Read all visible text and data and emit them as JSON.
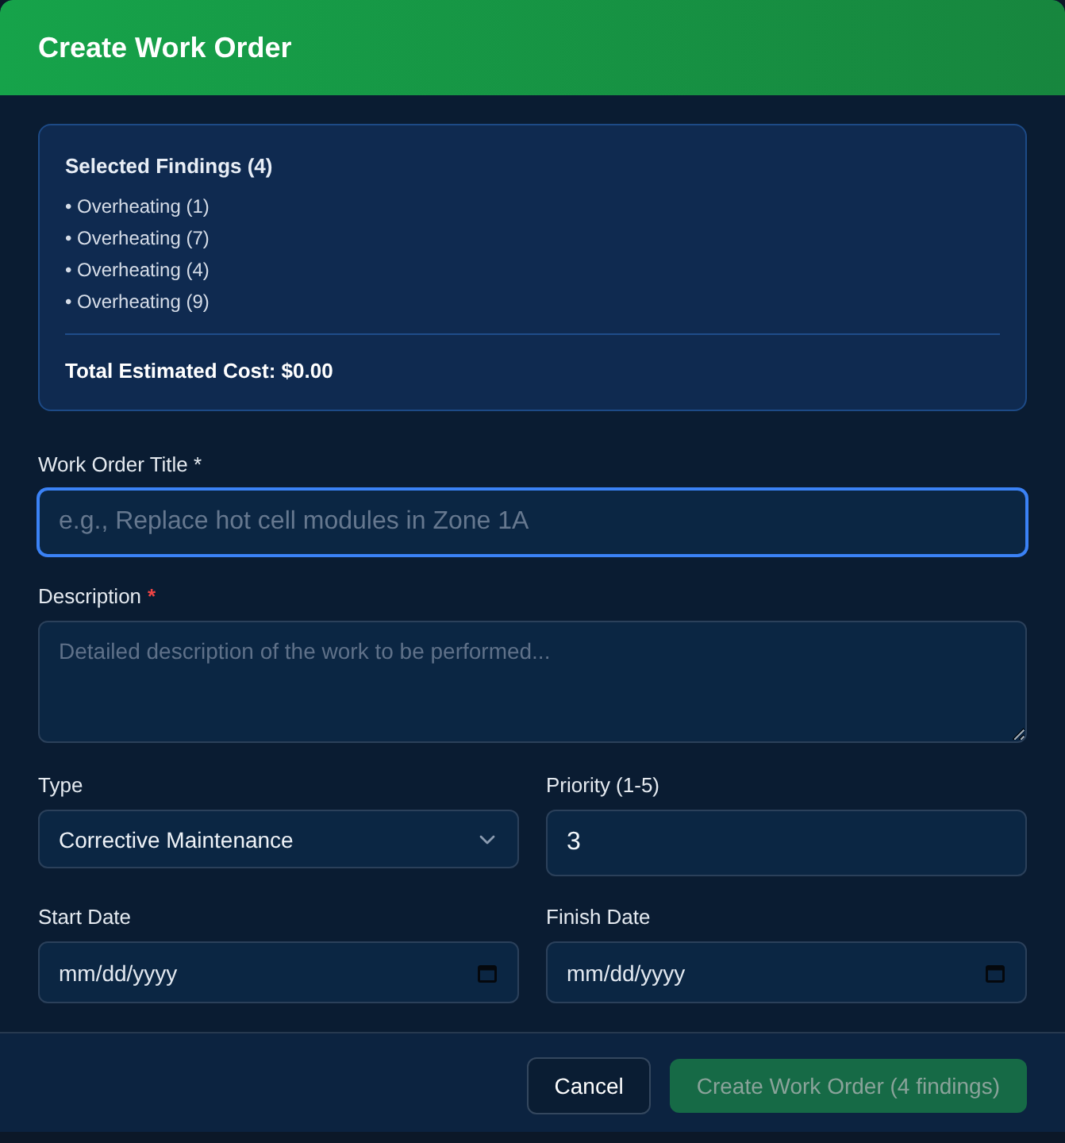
{
  "dialog": {
    "title": "Create Work Order"
  },
  "findings": {
    "heading": "Selected Findings (4)",
    "items": [
      "• Overheating (1)",
      "• Overheating (7)",
      "• Overheating (4)",
      "• Overheating (9)"
    ],
    "total": "Total Estimated Cost: $0.00"
  },
  "title_field": {
    "label": "Work Order Title *",
    "placeholder": "e.g., Replace hot cell modules in Zone 1A",
    "focused": true
  },
  "description_field": {
    "label": "Description",
    "required_mark": "*",
    "placeholder": "Detailed description of the work to be performed..."
  },
  "type_field": {
    "label": "Type",
    "value": "Corrective Maintenance"
  },
  "priority_field": {
    "label": "Priority (1-5)",
    "value": "3"
  },
  "start_date_field": {
    "label": "Start Date",
    "placeholder": "mm/dd/yyyy"
  },
  "finish_date_field": {
    "label": "Finish Date",
    "placeholder": "mm/dd/yyyy"
  },
  "buttons": [
    {
      "label": "Cancel",
      "kind": "secondary",
      "disabled": false
    },
    {
      "label": "Create Work Order (4 findings)",
      "kind": "primary",
      "disabled": true
    }
  ]
}
